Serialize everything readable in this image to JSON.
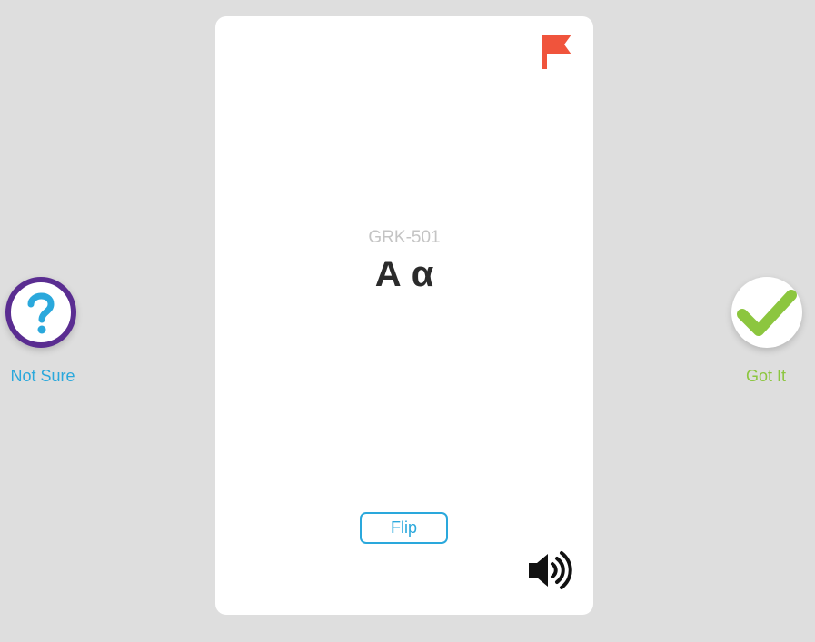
{
  "card": {
    "code": "GRK-501",
    "term": "Α α",
    "flip_label": "Flip",
    "flag_icon": "flag-icon",
    "speaker_icon": "speaker-icon"
  },
  "actions": {
    "not_sure_label": "Not Sure",
    "not_sure_icon": "question-icon",
    "got_it_label": "Got It",
    "got_it_icon": "checkmark-icon"
  },
  "colors": {
    "background": "#dedede",
    "card": "#ffffff",
    "flag": "#f0543c",
    "accent_blue": "#2aa8dc",
    "not_sure_ring": "#5a2d91",
    "got_it_green": "#8cc63f"
  }
}
